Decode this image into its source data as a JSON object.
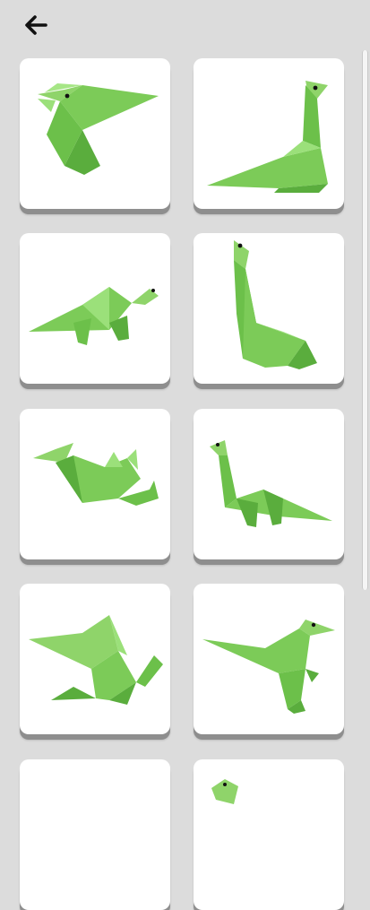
{
  "header": {
    "back_icon": "arrow-left-icon"
  },
  "colors": {
    "background": "#dcdcdc",
    "card": "#ffffff",
    "card_shadow": "#8e8e8e",
    "origami_light": "#8fd46a",
    "origami_mid": "#6cc04a",
    "origami_dark": "#4f9e33"
  },
  "gallery": {
    "items": [
      {
        "icon": "origami-pterodactyl-icon"
      },
      {
        "icon": "origami-sauropod-icon"
      },
      {
        "icon": "origami-brontosaurus-icon"
      },
      {
        "icon": "origami-brachiosaurus-icon"
      },
      {
        "icon": "origami-dragon-serpent-icon"
      },
      {
        "icon": "origami-diplodocus-icon"
      },
      {
        "icon": "origami-winged-dragon-icon"
      },
      {
        "icon": "origami-raptor-icon"
      },
      {
        "icon": "origami-partial-icon"
      },
      {
        "icon": "origami-partial-icon"
      }
    ]
  }
}
